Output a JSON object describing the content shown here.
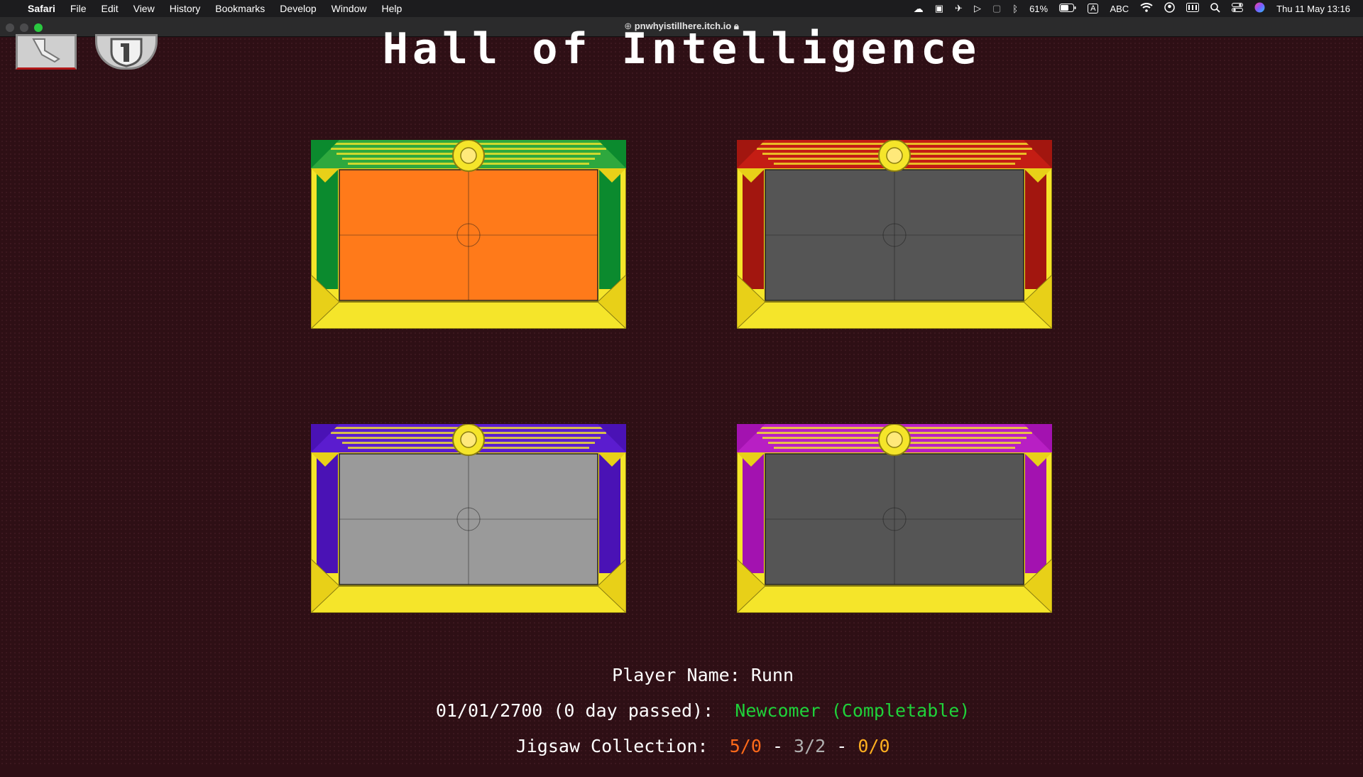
{
  "menubar": {
    "app": "Safari",
    "menus": [
      "File",
      "Edit",
      "View",
      "History",
      "Bookmarks",
      "Develop",
      "Window",
      "Help"
    ],
    "battery": "61%",
    "input": "ABC",
    "datetime": "Thu 11 May  13:16"
  },
  "browser": {
    "url": "pnwhyistillhere.itch.io"
  },
  "game": {
    "title": "Hall of Intelligence",
    "frames": [
      {
        "emblem": "sun-emblem",
        "side_color": "#0b8a2e",
        "top_color": "#2ea83e",
        "picture_color": "#ff7a1a"
      },
      {
        "emblem": "lion-emblem",
        "side_color": "#a2160f",
        "top_color": "#c41d14",
        "picture_color": "#555555"
      },
      {
        "emblem": "bear-emblem",
        "side_color": "#4a12b5",
        "top_color": "#5b1ccf",
        "picture_color": "#9a9a9a"
      },
      {
        "emblem": "lynx-emblem",
        "side_color": "#a312b0",
        "top_color": "#b81fc4",
        "picture_color": "#555555"
      }
    ],
    "player_label": "Player Name: ",
    "player_name": "Runn",
    "date_text": "01/01/2700 (0 day passed):",
    "status": "Newcomer (Completable)",
    "status_color": "#1fd23a",
    "collection_label": "Jigsaw Collection:",
    "collection": {
      "a": "5/0",
      "sep1": " - ",
      "b": "3/2",
      "sep2": " - ",
      "c": "0/0"
    },
    "collection_colors": {
      "a": "#ff6a1a",
      "b": "#b0b0b0",
      "c": "#ffb020"
    }
  }
}
